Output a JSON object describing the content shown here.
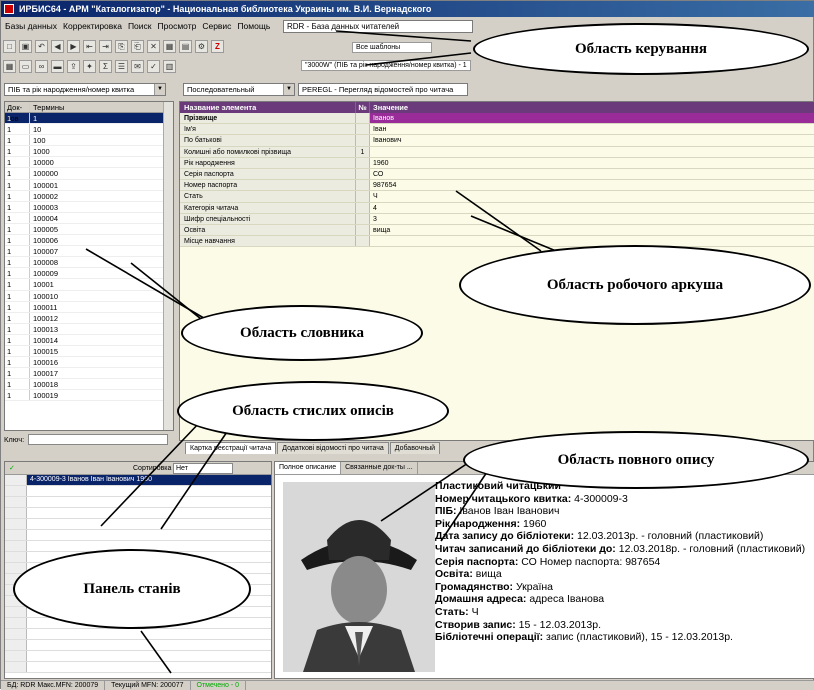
{
  "window": {
    "title": "ИРБИС64 - АРМ \"Каталогизатор\" - Национальная библиотека Украины им. В.И. Вернадского"
  },
  "menu": [
    "Базы данных",
    "Корректировка",
    "Поиск",
    "Просмотр",
    "Сервис",
    "Помощь"
  ],
  "database": "RDR - База данных читателей",
  "toolbar_hint_1": "Все шаблоны",
  "toolbar_hint_2": "\"3000W\" (ПІБ та рік народження/номер квитка) - 1",
  "dictionary": {
    "selector": "ПІБ та рік народження/номер квитка",
    "col_count": "Док-тов",
    "col_terms": "Термины",
    "terms": [
      "1",
      "10",
      "100",
      "1000",
      "10000",
      "100000",
      "100001",
      "100002",
      "100003",
      "100004",
      "100005",
      "100006",
      "100007",
      "100008",
      "100009",
      "10001",
      "100010",
      "100011",
      "100012",
      "100013",
      "100014",
      "100015",
      "100016",
      "100017",
      "100018",
      "100019"
    ],
    "counts": [
      "1",
      "1",
      "1",
      "1",
      "1",
      "1",
      "1",
      "1",
      "1",
      "1",
      "1",
      "1",
      "1",
      "1",
      "1",
      "1",
      "1",
      "1",
      "1",
      "1",
      "1",
      "1",
      "1",
      "1",
      "1",
      "1"
    ],
    "key_label": "Ключ:"
  },
  "worksheet": {
    "mode": "Последовательный",
    "form": "PEREGL - Перегляд відомостей про читача",
    "col_name": "Название элемента",
    "col_no": "№",
    "col_value": "Значение",
    "rows": [
      {
        "name": "Прізвище",
        "no": "",
        "value": "Іванов"
      },
      {
        "name": "Ім'я",
        "no": "",
        "value": "Іван"
      },
      {
        "name": "По батькові",
        "no": "",
        "value": "Іванович"
      },
      {
        "name": "Колишні або помилкові прізвища",
        "no": "1",
        "value": ""
      },
      {
        "name": "Рік народження",
        "no": "",
        "value": "1960"
      },
      {
        "name": "Серія паспорта",
        "no": "",
        "value": "СО"
      },
      {
        "name": "Номер паспорта",
        "no": "",
        "value": "987654"
      },
      {
        "name": "Стать",
        "no": "",
        "value": "Ч"
      },
      {
        "name": "Категорія читача",
        "no": "",
        "value": "4"
      },
      {
        "name": "Шифр спеціальності",
        "no": "",
        "value": "3"
      },
      {
        "name": "Освіта",
        "no": "",
        "value": "вища"
      },
      {
        "name": "Місце навчання",
        "no": "",
        "value": ""
      }
    ],
    "tabs": [
      "Картка реєстрації читача",
      "Додаткові відомості про читача",
      "Добавочный"
    ]
  },
  "brief": {
    "sort_label": "Сортировка",
    "sort_value": "Нет",
    "first_item": "4-300009-3 Іванов Іван Іванович 1960"
  },
  "full": {
    "tabs": [
      "Полное описание",
      "Связанные док-ты ..."
    ],
    "lines": [
      {
        "label": "Пластиковий читацький",
        "value": ""
      },
      {
        "label": "Номер читацького квитка:",
        "value": " 4-300009-3"
      },
      {
        "label": "ПІБ:",
        "value": " Іванов Іван Іванович"
      },
      {
        "label": "Рік народження:",
        "value": " 1960"
      },
      {
        "label": "Дата запису до бібліотеки:",
        "value": " 12.03.2013р. - головний (пластиковий)"
      },
      {
        "label": "Читач записаний до бібліотеки до:",
        "value": " 12.03.2018р. - головний (пластиковий)"
      },
      {
        "label": "Серія паспорта:",
        "value": " СО Номер паспорта: 987654"
      },
      {
        "label": "Освіта:",
        "value": " вища"
      },
      {
        "label": "Громадянство:",
        "value": " Україна"
      },
      {
        "label": "Домашня адреса:",
        "value": " адреса Іванова"
      },
      {
        "label": "Стать:",
        "value": " Ч"
      },
      {
        "label": "Створив запис:",
        "value": " 15 - 12.03.2013р."
      },
      {
        "label": "Бібліотечні операції:",
        "value": " запис (пластиковий), 15 - 12.03.2013р."
      }
    ]
  },
  "status": [
    "БД: RDR Макс.MFN: 200079",
    "Текущий MFN: 200077",
    "Отмечено - 0"
  ],
  "callouts": {
    "control": "Область керування",
    "worksheet": "Область робочого аркуша",
    "dictionary": "Область словника",
    "brief": "Область стислих описів",
    "full": "Область повного опису",
    "states": "Панель станів"
  }
}
